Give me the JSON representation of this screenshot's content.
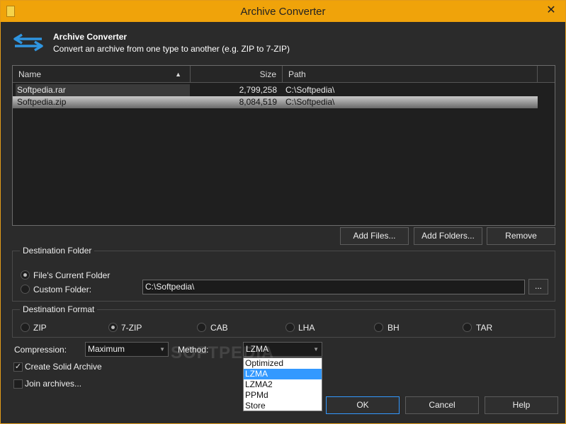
{
  "window": {
    "title": "Archive Converter",
    "close": "✕"
  },
  "header": {
    "title": "Archive Converter",
    "subtitle": "Convert an archive from one type to another (e.g. ZIP to 7-ZIP)"
  },
  "file_list": {
    "columns": [
      "Name",
      "Size",
      "Path"
    ],
    "sort_indicator": "▲",
    "rows": [
      {
        "name": "Softpedia.rar",
        "size": "2,799,258",
        "path": "C:\\Softpedia\\"
      },
      {
        "name": "Softpedia.zip",
        "size": "8,084,519",
        "path": "C:\\Softpedia\\"
      }
    ]
  },
  "list_buttons": {
    "add_files": "Add Files...",
    "add_folders": "Add Folders...",
    "remove": "Remove"
  },
  "destination_folder": {
    "label": "Destination Folder",
    "current_folder": "File's Current Folder",
    "custom_folder": "Custom Folder:",
    "custom_path": "C:\\Softpedia\\",
    "browse": "..."
  },
  "destination_format": {
    "label": "Destination Format",
    "options": [
      "ZIP",
      "7-ZIP",
      "CAB",
      "LHA",
      "BH",
      "TAR"
    ],
    "selected": "7-ZIP"
  },
  "options": {
    "compression_label": "Compression:",
    "compression_value": "Maximum",
    "method_label": "Method:",
    "method_value": "LZMA",
    "method_options": [
      "Optimized",
      "LZMA",
      "LZMA2",
      "PPMd",
      "Store"
    ],
    "method_highlighted": "LZMA",
    "solid_archive": "Create Solid Archive",
    "solid_checked": true,
    "join_archives": "Join archives...",
    "join_checked": false
  },
  "footer_buttons": {
    "ok": "OK",
    "cancel": "Cancel",
    "help": "Help"
  },
  "watermark": "SOFTPEDIA",
  "colors": {
    "title_bar": "#f0a30a",
    "selection": "#3399ff",
    "background": "#2b2b2b"
  }
}
